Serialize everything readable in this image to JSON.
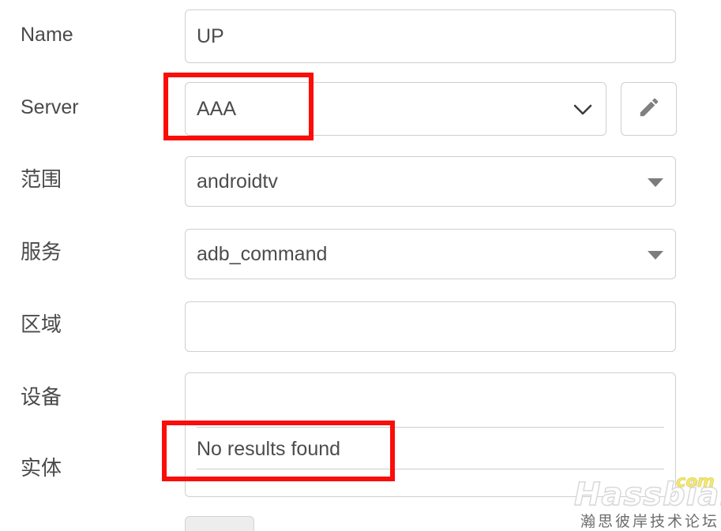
{
  "form": {
    "rows": [
      {
        "label": "Name",
        "value": "UP",
        "control": "text-input",
        "icon": "none"
      },
      {
        "label": "Server",
        "value": "AAA",
        "control": "select",
        "icon": "chevron-down-icon",
        "highlighted": true,
        "action_button": {
          "label": "",
          "icon": "pencil-icon"
        }
      },
      {
        "label": "范围",
        "value": "androidtv",
        "control": "select",
        "icon": "caret-down-icon"
      },
      {
        "label": "服务",
        "value": "adb_command",
        "control": "select",
        "icon": "caret-down-icon"
      },
      {
        "label": "区域",
        "value": "",
        "control": "select",
        "icon": "none"
      },
      {
        "label": "设备",
        "value": "",
        "control": "select",
        "icon": "none"
      },
      {
        "label": "实体",
        "value": "",
        "control": "combobox-open",
        "icon": "none"
      }
    ]
  },
  "entity_dropdown": {
    "empty_message": "No results found",
    "highlighted": true
  },
  "watermark": {
    "brand": "Hassbian",
    "tld": "com",
    "subtitle": "瀚思彼岸技术论坛"
  },
  "colors": {
    "highlight": "#fb0d09",
    "field_border": "#cfcfcf",
    "text": "#4c4c4c",
    "label": "#4a4a4a",
    "separator": "#cdcdcd",
    "chip_fill": "#ededed"
  }
}
